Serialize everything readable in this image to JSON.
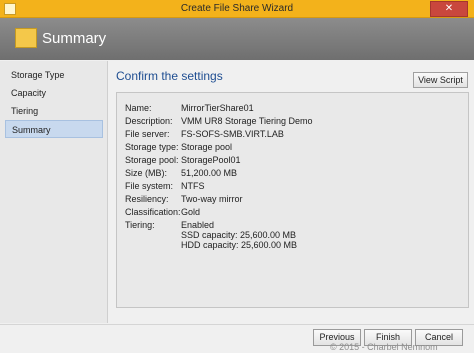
{
  "window": {
    "title": "Create File Share Wizard",
    "close_label": "✕"
  },
  "header": {
    "title": "Summary",
    "icon": "folder-icon"
  },
  "sidebar": {
    "items": [
      {
        "label": "Storage Type",
        "active": false
      },
      {
        "label": "Capacity",
        "active": false
      },
      {
        "label": "Tiering",
        "active": false
      },
      {
        "label": "Summary",
        "active": true
      }
    ]
  },
  "main": {
    "section_title": "Confirm the settings",
    "view_script_label": "View Script",
    "settings": [
      {
        "label": "Name:",
        "value": "MirrorTierShare01"
      },
      {
        "label": "Description:",
        "value": "VMM UR8 Storage Tiering Demo"
      },
      {
        "label": "File server:",
        "value": "FS-SOFS-SMB.VIRT.LAB"
      },
      {
        "label": "Storage type:",
        "value": "Storage pool"
      },
      {
        "label": "Storage pool:",
        "value": "StoragePool01"
      },
      {
        "label": "Size (MB):",
        "value": "51,200.00 MB"
      },
      {
        "label": "File system:",
        "value": "NTFS"
      },
      {
        "label": "Resiliency:",
        "value": "Two-way mirror"
      },
      {
        "label": "Classification:",
        "value": "Gold"
      },
      {
        "label": "Tiering:",
        "lines": [
          "Enabled",
          "SSD capacity: 25,600.00 MB",
          "HDD capacity: 25,600.00 MB"
        ]
      }
    ]
  },
  "footer": {
    "previous_label": "Previous",
    "finish_label": "Finish",
    "cancel_label": "Cancel"
  },
  "watermark": "© 2015 - Charbel Nemnom"
}
